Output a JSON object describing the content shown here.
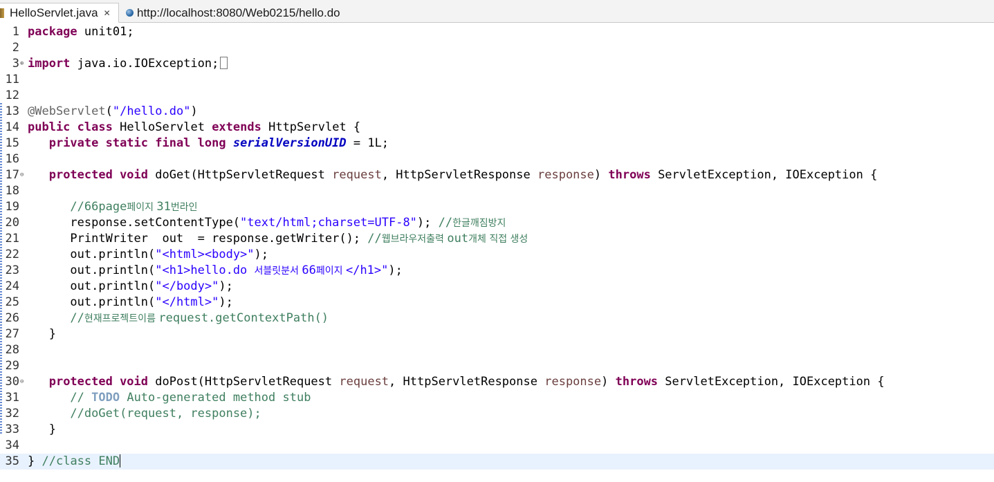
{
  "tabs": [
    {
      "label": "HelloServlet.java",
      "active": true,
      "icon": "java-file-icon",
      "close": "✕"
    },
    {
      "label": "http://localhost:8080/Web0215/hello.do",
      "active": false,
      "icon": "globe-icon"
    }
  ],
  "lines": [
    {
      "n": "1",
      "tokens": [
        [
          "kw",
          "package"
        ],
        [
          "",
          "unit01;"
        ]
      ]
    },
    {
      "n": "2",
      "tokens": []
    },
    {
      "n": "3",
      "fold": "⊕",
      "tokens": [
        [
          "kw",
          "import"
        ],
        [
          "",
          "java.io.IOException;"
        ]
      ],
      "folded": true
    },
    {
      "n": "11",
      "tokens": []
    },
    {
      "n": "12",
      "tokens": []
    },
    {
      "n": "13",
      "tokens": [
        [
          "ann",
          "@WebServlet"
        ],
        [
          "",
          "("
        ],
        [
          "str",
          "\"/hello.do\""
        ],
        [
          "",
          ")"
        ]
      ]
    },
    {
      "n": "14",
      "tokens": [
        [
          "kw",
          "public"
        ],
        [
          "",
          ""
        ],
        [
          "kw",
          "class"
        ],
        [
          "",
          "HelloServlet"
        ],
        [
          "kw",
          "extends"
        ],
        [
          "",
          "HttpServlet {"
        ]
      ]
    },
    {
      "n": "15",
      "tokens": [
        [
          "",
          "   "
        ],
        [
          "kw",
          "private static final long"
        ],
        [
          "field",
          "serialVersionUID"
        ],
        [
          "",
          "= 1L;"
        ]
      ]
    },
    {
      "n": "16",
      "tokens": []
    },
    {
      "n": "17",
      "fold": "⊖",
      "tokens": [
        [
          "",
          "   "
        ],
        [
          "kw",
          "protected void"
        ],
        [
          "",
          "doGet(HttpServletRequest"
        ],
        [
          "param",
          "request"
        ],
        [
          "",
          ", HttpServletResponse"
        ],
        [
          "param",
          "response"
        ],
        [
          "",
          ")"
        ],
        [
          "kw",
          "throws"
        ],
        [
          "",
          "ServletException, IOException {"
        ]
      ]
    },
    {
      "n": "18",
      "tokens": []
    },
    {
      "n": "19",
      "tokens": [
        [
          "",
          "      "
        ],
        [
          "com",
          "//66page"
        ],
        [
          "comkr",
          "페이지 "
        ],
        [
          "com",
          "31"
        ],
        [
          "comkr",
          "번라인"
        ]
      ]
    },
    {
      "n": "20",
      "tokens": [
        [
          "",
          "      response.setContentType("
        ],
        [
          "str",
          "\"text/html;charset=UTF-8\""
        ],
        [
          "",
          ");"
        ],
        [
          "com",
          " //"
        ],
        [
          "comkr",
          "한글깨짐방지"
        ]
      ]
    },
    {
      "n": "21",
      "tokens": [
        [
          "",
          "      PrintWriter  out  = response.getWriter();"
        ],
        [
          "com",
          " //"
        ],
        [
          "comkr",
          "웹브라우저출력 "
        ],
        [
          "com",
          "out"
        ],
        [
          "comkr",
          "개체 직접 생성"
        ]
      ]
    },
    {
      "n": "22",
      "tokens": [
        [
          "",
          "      out.println("
        ],
        [
          "str",
          "\"<html><body>\""
        ],
        [
          "",
          ");"
        ]
      ]
    },
    {
      "n": "23",
      "tokens": [
        [
          "",
          "      out.println("
        ],
        [
          "str",
          "\"<h1>hello.do "
        ],
        [
          "strkr",
          "서블릿분서 "
        ],
        [
          "str",
          "66"
        ],
        [
          "strkr",
          "페이지 "
        ],
        [
          "str",
          "</h1>\""
        ],
        [
          "",
          ");"
        ]
      ]
    },
    {
      "n": "24",
      "tokens": [
        [
          "",
          "      out.println("
        ],
        [
          "str",
          "\"</body>\""
        ],
        [
          "",
          ");"
        ]
      ]
    },
    {
      "n": "25",
      "tokens": [
        [
          "",
          "      out.println("
        ],
        [
          "str",
          "\"</html>\""
        ],
        [
          "",
          ");"
        ]
      ]
    },
    {
      "n": "26",
      "tokens": [
        [
          "",
          "      "
        ],
        [
          "com",
          "//"
        ],
        [
          "comkr",
          "현재프로젝트이름 "
        ],
        [
          "com",
          "request.getContextPath()"
        ]
      ]
    },
    {
      "n": "27",
      "tokens": [
        [
          "",
          "   }"
        ]
      ]
    },
    {
      "n": "28",
      "tokens": []
    },
    {
      "n": "29",
      "tokens": []
    },
    {
      "n": "30",
      "fold": "⊖",
      "tokens": [
        [
          "",
          "   "
        ],
        [
          "kw",
          "protected void"
        ],
        [
          "",
          "doPost(HttpServletRequest"
        ],
        [
          "param",
          "request"
        ],
        [
          "",
          ", HttpServletResponse"
        ],
        [
          "param",
          "response"
        ],
        [
          "",
          ")"
        ],
        [
          "kw",
          "throws"
        ],
        [
          "",
          "ServletException, IOException {"
        ]
      ]
    },
    {
      "n": "31",
      "tokens": [
        [
          "",
          "      "
        ],
        [
          "com",
          "// "
        ],
        [
          "todo",
          "TODO"
        ],
        [
          "com",
          " Auto-generated method stub"
        ]
      ]
    },
    {
      "n": "32",
      "tokens": [
        [
          "",
          "      "
        ],
        [
          "com",
          "//doGet(request, response);"
        ]
      ]
    },
    {
      "n": "33",
      "tokens": [
        [
          "",
          "   }"
        ]
      ]
    },
    {
      "n": "34",
      "tokens": []
    },
    {
      "n": "35",
      "current": true,
      "caret": true,
      "tokens": [
        [
          "",
          "}"
        ],
        [
          "com",
          "//class END"
        ]
      ]
    }
  ],
  "colors": {
    "keyword": "#7f0055",
    "string": "#2a00ff",
    "comment": "#3f7f5f",
    "annotation": "#646464",
    "parameter": "#6a3e3e",
    "field": "#0000c0",
    "current_line": "#e8f2fe"
  }
}
